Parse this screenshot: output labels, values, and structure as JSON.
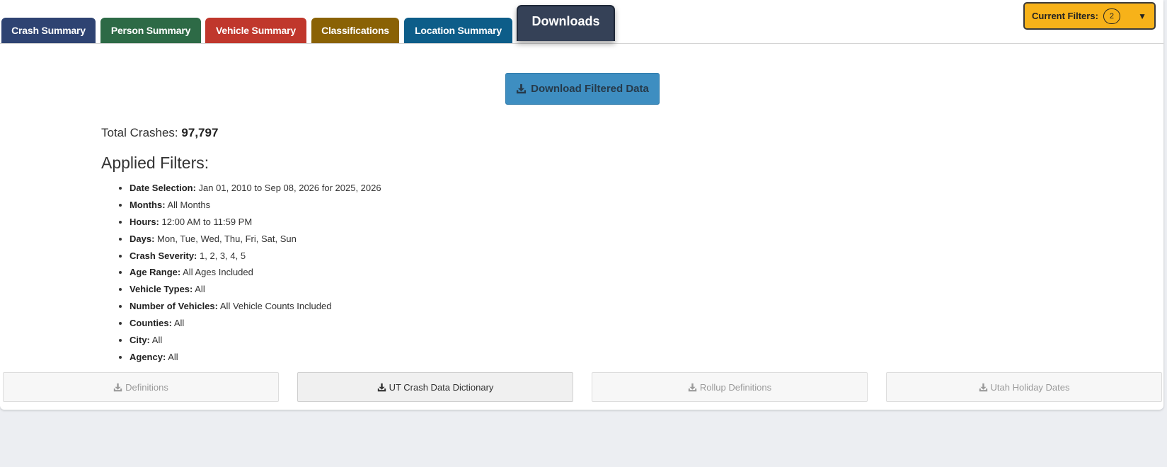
{
  "tabs": [
    {
      "label": "Crash Summary",
      "color": "#2e4372"
    },
    {
      "label": "Person Summary",
      "color": "#2d6a46"
    },
    {
      "label": "Vehicle Summary",
      "color": "#c0372c"
    },
    {
      "label": "Classifications",
      "color": "#8a6205"
    },
    {
      "label": "Location Summary",
      "color": "#0d5d89"
    }
  ],
  "active_tab": {
    "label": "Downloads",
    "color": "#354157"
  },
  "current_filters": {
    "label": "Current Filters:",
    "count": "2",
    "caret": "▼",
    "color": "#f7b219"
  },
  "download_filtered": {
    "label": "Download Filtered Data",
    "icon": "download-icon",
    "color": "#3e8ec1"
  },
  "total": {
    "label": "Total Crashes:",
    "value": "97,797"
  },
  "applied_filters": {
    "heading": "Applied Filters:",
    "items": [
      {
        "key": "Date Selection:",
        "value": "Jan 01, 2010 to Sep 08, 2026 for 2025, 2026"
      },
      {
        "key": "Months:",
        "value": "All Months"
      },
      {
        "key": "Hours:",
        "value": "12:00 AM to 11:59 PM"
      },
      {
        "key": "Days:",
        "value": "Mon, Tue, Wed, Thu, Fri, Sat, Sun"
      },
      {
        "key": "Crash Severity:",
        "value": "1, 2, 3, 4, 5"
      },
      {
        "key": "Age Range:",
        "value": "All Ages Included"
      },
      {
        "key": "Vehicle Types:",
        "value": "All"
      },
      {
        "key": "Number of Vehicles:",
        "value": "All Vehicle Counts Included"
      },
      {
        "key": "Counties:",
        "value": "All"
      },
      {
        "key": "City:",
        "value": "All"
      },
      {
        "key": "Agency:",
        "value": "All"
      }
    ]
  },
  "downloads": [
    {
      "label": "Definitions",
      "icon": "download-icon",
      "enabled": false
    },
    {
      "label": "UT Crash Data Dictionary",
      "icon": "download-icon",
      "enabled": true
    },
    {
      "label": "Rollup Definitions",
      "icon": "download-icon",
      "enabled": false
    },
    {
      "label": "Utah Holiday Dates",
      "icon": "download-icon",
      "enabled": false
    }
  ]
}
